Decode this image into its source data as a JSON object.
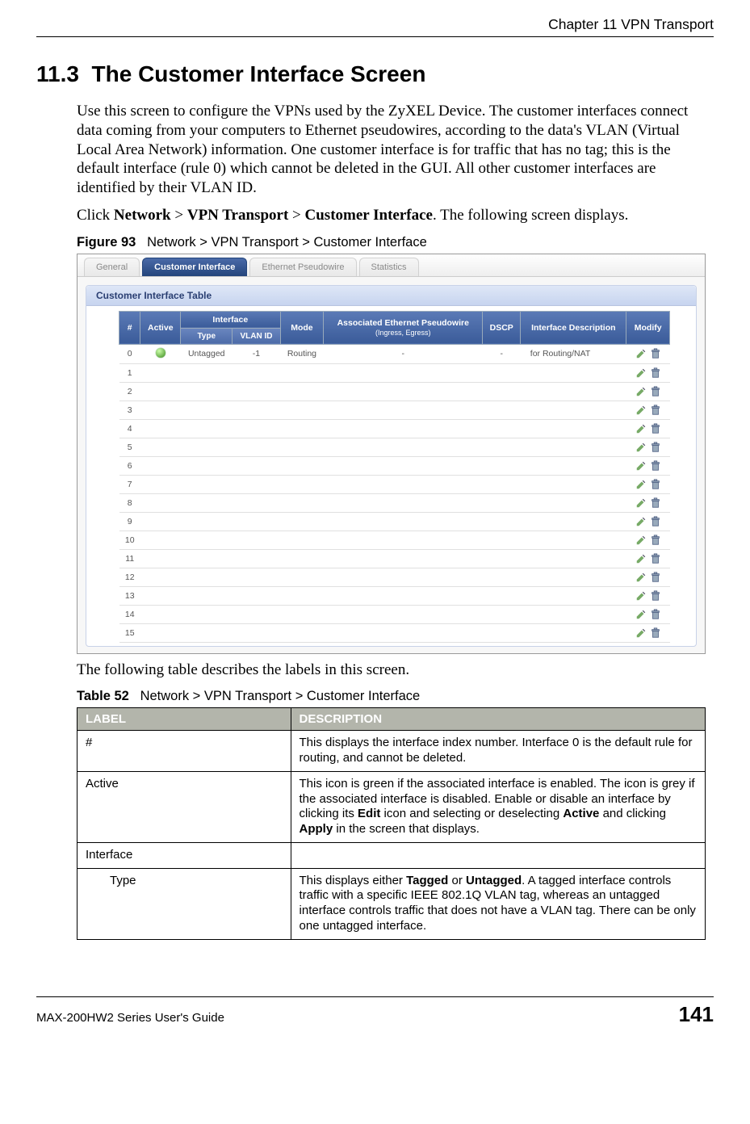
{
  "header": {
    "chapter": "Chapter 11 VPN Transport"
  },
  "section": {
    "number": "11.3",
    "title": "The Customer Interface Screen"
  },
  "paragraphs": {
    "p1": "Use this screen to configure the VPNs used by the ZyXEL Device. The customer interfaces connect data coming from your computers to Ethernet pseudowires, according to the data's VLAN (Virtual Local Area Network) information. One customer interface is for traffic that has no tag; this is the default interface (rule 0) which cannot be deleted in the GUI. All other customer interfaces are identified by their VLAN ID.",
    "p2_pre": "Click ",
    "p2_b1": "Network",
    "p2_mid1": " > ",
    "p2_b2": "VPN Transport",
    "p2_mid2": " > ",
    "p2_b3": "Customer Interface",
    "p2_post": ". The following screen displays."
  },
  "figure": {
    "label": "Figure 93",
    "caption": "Network > VPN Transport > Customer Interface"
  },
  "screenshot": {
    "tabs": [
      "General",
      "Customer Interface",
      "Ethernet Pseudowire",
      "Statistics"
    ],
    "active_tab_index": 1,
    "panel_title": "Customer Interface Table",
    "headers": {
      "num": "#",
      "active": "Active",
      "interface": "Interface",
      "type": "Type",
      "vlan": "VLAN ID",
      "mode": "Mode",
      "assoc": "Associated Ethernet Pseudowire",
      "assoc_sub": "(Ingress, Egress)",
      "dscp": "DSCP",
      "desc": "Interface Description",
      "modify": "Modify"
    },
    "rows": [
      {
        "n": "0",
        "active": true,
        "type": "Untagged",
        "vlan": "-1",
        "mode": "Routing",
        "assoc": "-",
        "dscp": "-",
        "desc": "for Routing/NAT"
      },
      {
        "n": "1"
      },
      {
        "n": "2"
      },
      {
        "n": "3"
      },
      {
        "n": "4"
      },
      {
        "n": "5"
      },
      {
        "n": "6"
      },
      {
        "n": "7"
      },
      {
        "n": "8"
      },
      {
        "n": "9"
      },
      {
        "n": "10"
      },
      {
        "n": "11"
      },
      {
        "n": "12"
      },
      {
        "n": "13"
      },
      {
        "n": "14"
      },
      {
        "n": "15"
      }
    ]
  },
  "after_figure": "The following table describes the labels in this screen.",
  "table": {
    "label": "Table 52",
    "caption": "Network > VPN Transport > Customer Interface",
    "head_label": "LABEL",
    "head_desc": "DESCRIPTION",
    "rows": [
      {
        "label": "#",
        "desc_parts": [
          "This displays the interface index number. Interface 0 is the default rule for routing, and cannot be deleted."
        ]
      },
      {
        "label": "Active",
        "desc_parts": [
          "This icon is green if the associated interface is enabled. The icon is grey if the associated interface is disabled. Enable or disable an interface by clicking its ",
          {
            "b": "Edit"
          },
          " icon and selecting or deselecting ",
          {
            "b": "Active"
          },
          " and clicking ",
          {
            "b": "Apply"
          },
          " in the screen that displays."
        ]
      },
      {
        "label": "Interface",
        "desc_parts": [
          ""
        ]
      },
      {
        "label": "Type",
        "indent": true,
        "desc_parts": [
          "This displays either ",
          {
            "b": "Tagged"
          },
          " or ",
          {
            "b": "Untagged"
          },
          ". A tagged interface controls traffic with a specific IEEE 802.1Q VLAN tag, whereas an untagged interface controls traffic that does not have a VLAN tag. There can be only one untagged interface."
        ]
      }
    ]
  },
  "footer": {
    "guide": "MAX-200HW2 Series User's Guide",
    "page": "141"
  }
}
